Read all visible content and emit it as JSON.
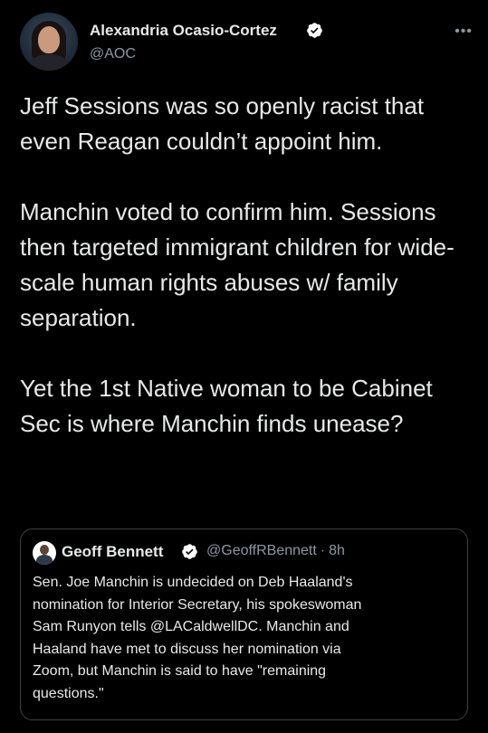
{
  "tweet": {
    "author": {
      "name": "Alexandria Ocasio-Cortez",
      "handle": "@AOC",
      "verified": true
    },
    "more_label": "•••",
    "paragraphs": [
      "Jeff Sessions was so openly racist that even Reagan couldn’t appoint him.",
      "Manchin voted to confirm him. Sessions then targeted immigrant children for wide-scale human rights abuses w/ family separation.",
      "Yet the 1st Native woman to be Cabinet Sec is where Manchin finds unease?"
    ]
  },
  "quote": {
    "author": {
      "name": "Geoff Bennett",
      "handle": "@GeoffRBennett",
      "verified": true
    },
    "separator": "·",
    "time": "8h",
    "text": "Sen. Joe Manchin is undecided on Deb Haaland's\nnomination for Interior Secretary, his spokeswoman\nSam Runyon tells @LACaldwellDC. Manchin and\nHaaland have met to discuss her nomination via\nZoom, but Manchin is said to have \"remaining\nquestions.\""
  },
  "colors": {
    "background": "#000000",
    "text": "#e7e9ea",
    "secondary": "#8b98a5",
    "verified": "#ffffff",
    "border": "#3b4148"
  }
}
